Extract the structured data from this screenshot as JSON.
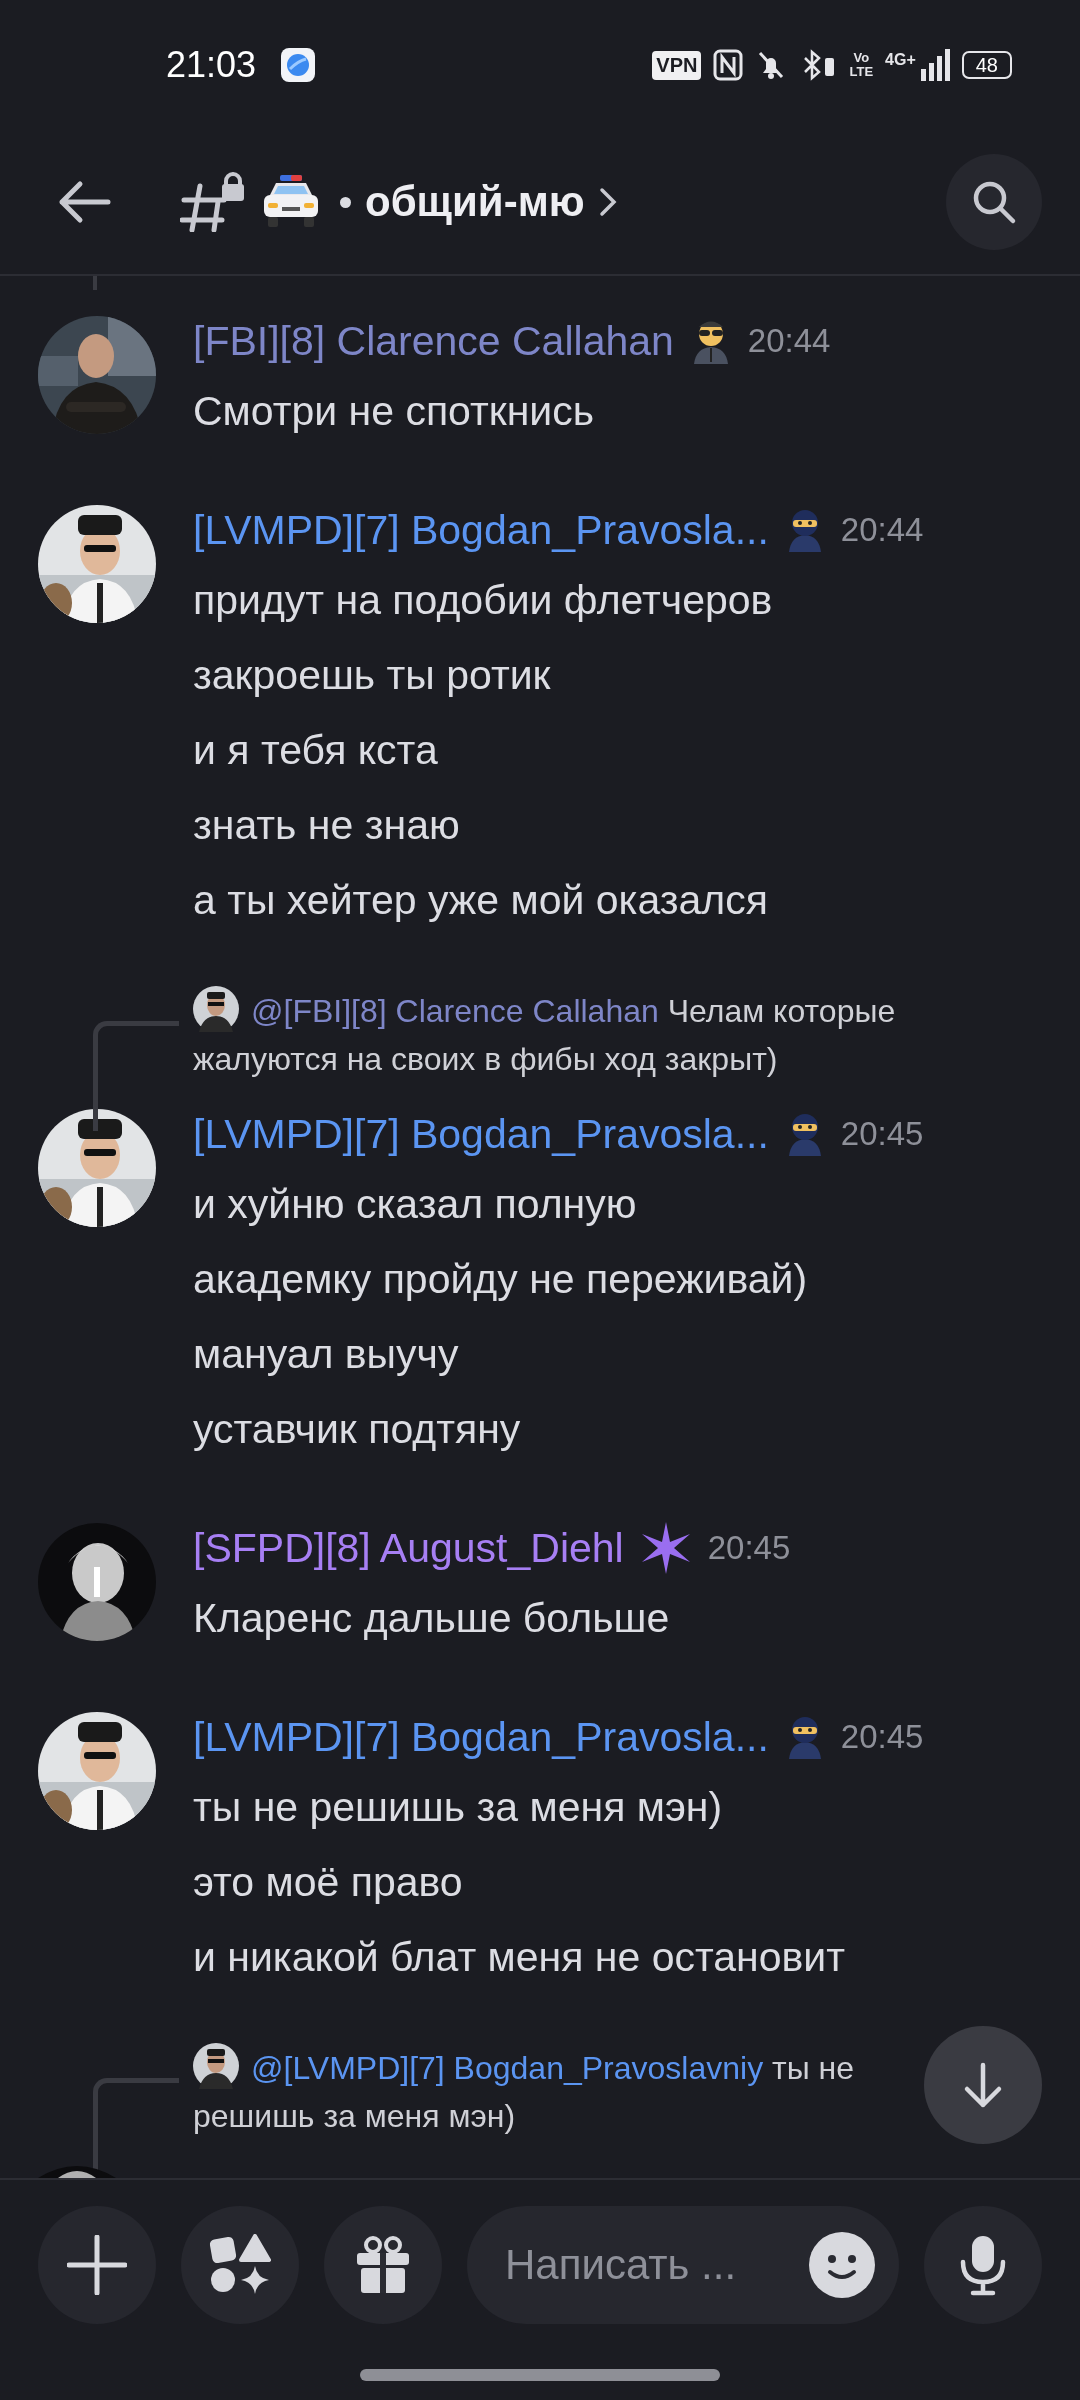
{
  "status_bar": {
    "time": "21:03",
    "vpn": "VPN",
    "volte_top": "Vo",
    "volte_bottom": "LTE",
    "network": "4G+",
    "battery": "48"
  },
  "channel": {
    "name": "общий-мю"
  },
  "messages": [
    {
      "kind": "message",
      "author": "[FBI][8] Clarence Callahan",
      "color": "#7e86c8",
      "badge": {
        "kind": "agent"
      },
      "time": "20:44",
      "lines": [
        "Смотри не споткнись"
      ]
    },
    {
      "kind": "message",
      "author": "[LVMPD][7] Bogdan_Pravosla...",
      "color": "#5b95f2",
      "badge": {
        "kind": "ninja"
      },
      "time": "20:44",
      "lines": [
        "придут на подобии флетчеров",
        "закроешь ты ротик",
        "и я тебя кста",
        "знать не знаю",
        "а ты хейтер уже мой оказался"
      ]
    },
    {
      "kind": "reply",
      "mention": "@[FBI][8] Clarence Callahan",
      "color": "#7e86c8",
      "text": "Челам которые жалуются на своих в фибы ход закрыт)"
    },
    {
      "kind": "message",
      "author": "[LVMPD][7] Bogdan_Pravosla...",
      "color": "#5b95f2",
      "badge": {
        "kind": "ninja"
      },
      "time": "20:45",
      "lines": [
        "и хуйню сказал полную",
        "академку пройду не переживай)",
        "мануал выучу",
        "уставчик подтяну"
      ]
    },
    {
      "kind": "message",
      "author": "[SFPD][8] August_Diehl",
      "color": "#a77ff4",
      "badge": {
        "kind": "sparkle"
      },
      "time": "20:45",
      "lines": [
        "Кларенс дальше больше"
      ]
    },
    {
      "kind": "message",
      "author": "[LVMPD][7] Bogdan_Pravosla...",
      "color": "#5b95f2",
      "badge": {
        "kind": "ninja"
      },
      "time": "20:45",
      "lines": [
        "ты не решишь за меня мэн)",
        "это моё право",
        "и никакой блат меня не остановит"
      ]
    },
    {
      "kind": "reply",
      "mention": "@[LVMPD][7] Bogdan_Pravoslavniy",
      "color": "#5b95f2",
      "text": "ты не решишь за меня мэн)"
    }
  ],
  "composer": {
    "placeholder": "Написать ..."
  }
}
